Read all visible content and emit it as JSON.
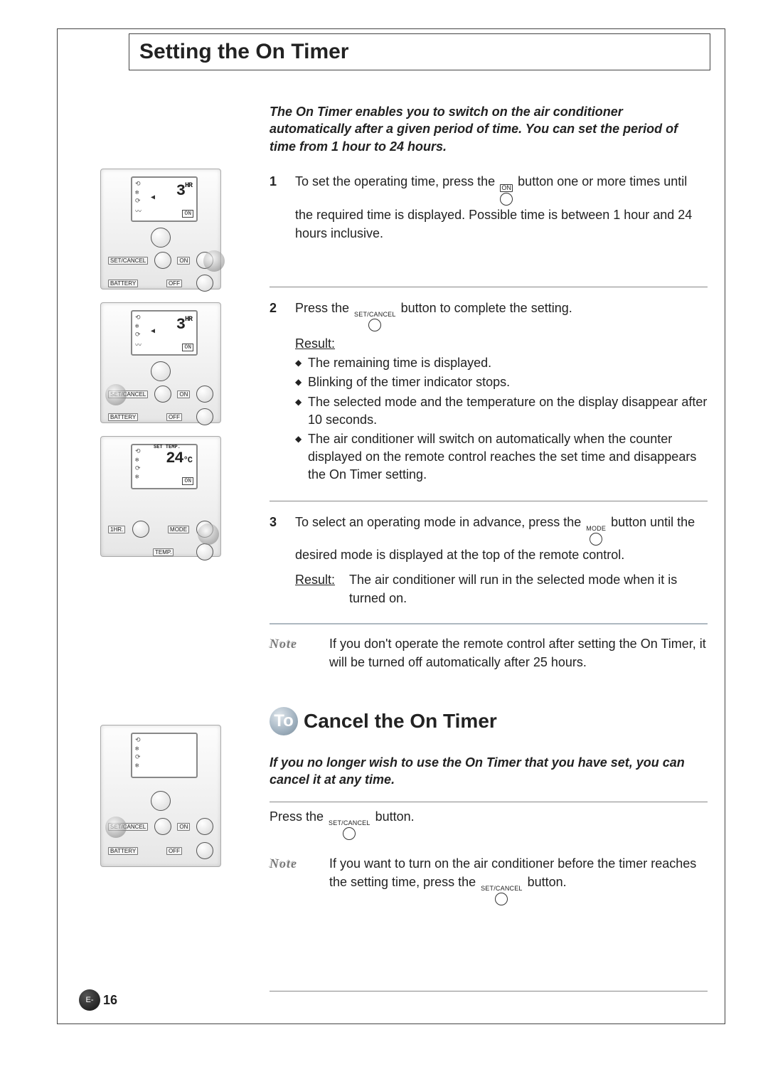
{
  "title": "Setting the On Timer",
  "intro": "The On Timer enables you to switch on the air conditioner automatically after a given period of time. You can set the period of time from 1 hour to 24 hours.",
  "buttons": {
    "on": "ON",
    "set_cancel": "SET/CANCEL",
    "mode": "MODE"
  },
  "steps": [
    {
      "num": "1",
      "before": "To set the operating time, press the ",
      "button": "on",
      "after": " button one or more times until the required time is displayed. Possible time is between 1 hour and 24 hours inclusive."
    },
    {
      "num": "2",
      "before": "Press the ",
      "button": "set_cancel",
      "after": " button to complete the setting.",
      "result_label": "Result:",
      "bullets": [
        "The remaining time is displayed.",
        "Blinking of the timer indicator stops.",
        "The selected mode and the temperature on the display disappear after 10 seconds.",
        "The air conditioner will switch on automatically when the counter displayed on the remote control reaches the set time and disappears the On Timer setting."
      ]
    },
    {
      "num": "3",
      "before": "To select an operating mode in advance, press the ",
      "button": "mode",
      "after": " button until the desired mode is displayed at the top of the remote control.",
      "result_label": "Result:",
      "result_text": "The air conditioner will run in the selected mode when it is turned on."
    }
  ],
  "note1": {
    "label": "Note",
    "text": "If you don't operate the remote control after setting the On Timer, it will be turned off automatically after 25 hours."
  },
  "section2": {
    "badge": "To",
    "title": "Cancel the On Timer",
    "intro": "If you no longer wish to use the On Timer that you have set, you can cancel it at any time.",
    "action_before": "Press the ",
    "action_button": "set_cancel",
    "action_after": " button.",
    "note": {
      "label": "Note",
      "before": "If you want to turn on the air conditioner before the timer reaches the setting time, press the ",
      "button": "set_cancel",
      "after": " button."
    }
  },
  "figures": {
    "f1": {
      "big": "3",
      "unit": "HR",
      "sub": "ON",
      "set_cancel": "SET/CANCEL",
      "on": "ON",
      "off": "OFF",
      "battery": "BATTERY"
    },
    "f2": {
      "big": "3",
      "unit": "HR",
      "sub": "ON",
      "set_cancel": "SET/CANCEL",
      "on": "ON",
      "off": "OFF",
      "battery": "BATTERY"
    },
    "f3": {
      "top": "SET TEMP.",
      "big": "24",
      "unit": "°C",
      "sub": "ON",
      "hr": "1HR.",
      "mode": "MODE",
      "temp": "TEMP."
    },
    "f4": {
      "set_cancel": "SET/CANCEL",
      "on": "ON",
      "off": "OFF",
      "battery": "BATTERY"
    }
  },
  "page": {
    "prefix": "E-",
    "num": "16"
  }
}
